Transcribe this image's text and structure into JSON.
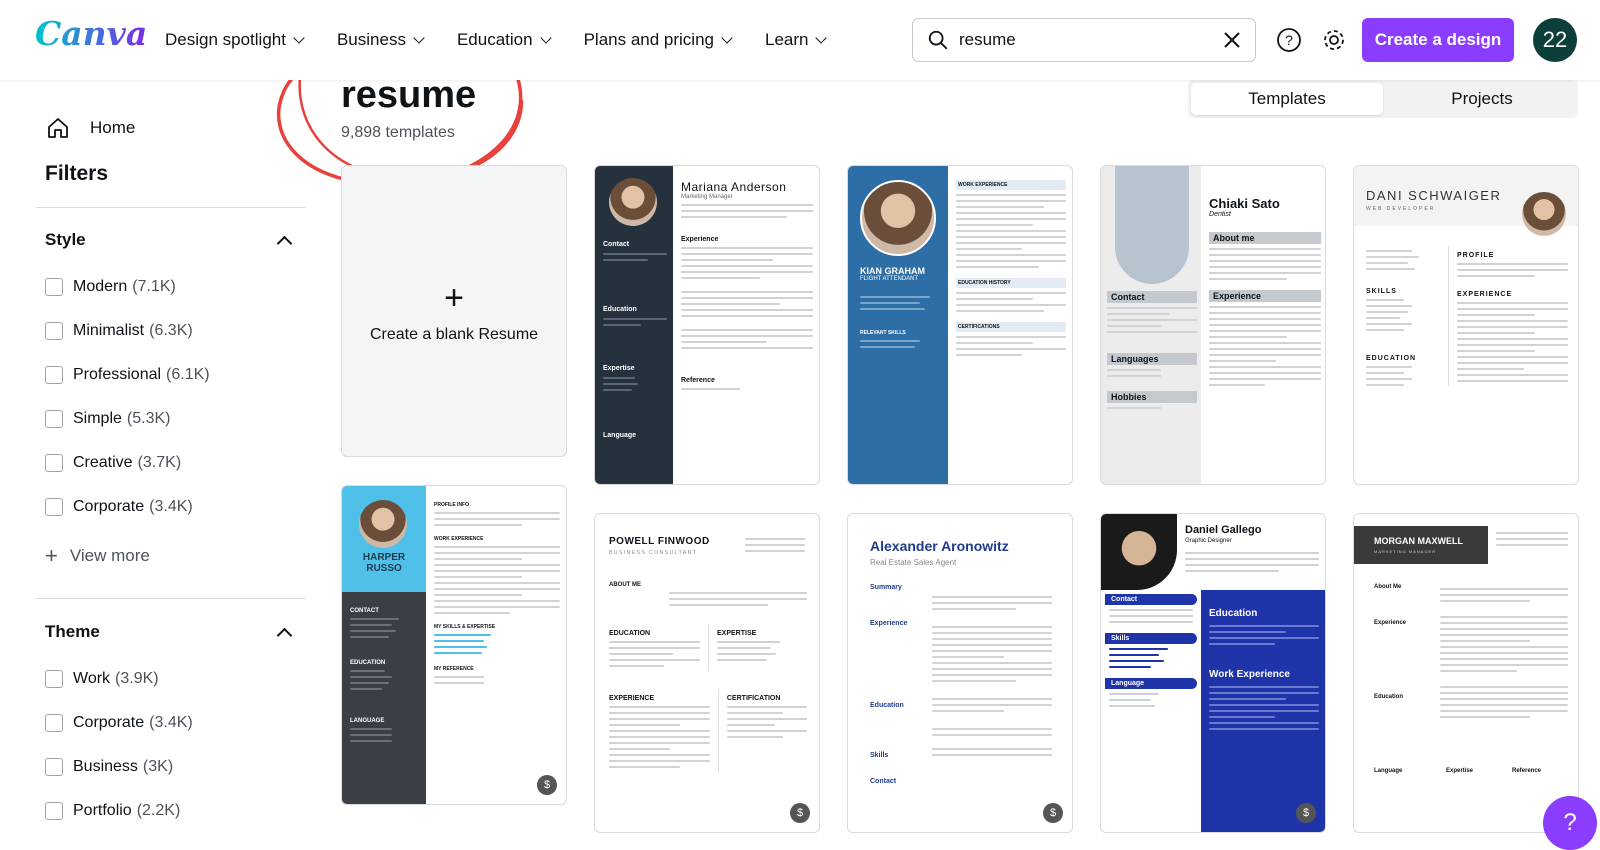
{
  "header": {
    "logo": "Canva",
    "nav": [
      "Design spotlight",
      "Business",
      "Education",
      "Plans and pricing",
      "Learn"
    ],
    "search_value": "resume",
    "create_label": "Create a design",
    "avatar_text": "22"
  },
  "sidebar": {
    "home_label": "Home",
    "filters_title": "Filters",
    "style_title": "Style",
    "style_items": [
      {
        "label": "Modern",
        "count": "(7.1K)"
      },
      {
        "label": "Minimalist",
        "count": "(6.3K)"
      },
      {
        "label": "Professional",
        "count": "(6.1K)"
      },
      {
        "label": "Simple",
        "count": "(5.3K)"
      },
      {
        "label": "Creative",
        "count": "(3.7K)"
      },
      {
        "label": "Corporate",
        "count": "(3.4K)"
      }
    ],
    "view_more": "View more",
    "theme_title": "Theme",
    "theme_items": [
      {
        "label": "Work",
        "count": "(3.9K)"
      },
      {
        "label": "Corporate",
        "count": "(3.4K)"
      },
      {
        "label": "Business",
        "count": "(3K)"
      },
      {
        "label": "Portfolio",
        "count": "(2.2K)"
      }
    ]
  },
  "main": {
    "title": "resume",
    "subtitle": "9,898 templates",
    "tabs": [
      "Templates",
      "Projects"
    ],
    "blank_label": "Create a blank Resume"
  },
  "templates": {
    "mariana": {
      "name": "Mariana Anderson",
      "role": "Marketing Manager",
      "s1": "Contact",
      "s2": "Education",
      "s3": "Expertise",
      "s4": "Language",
      "s5": "Experience",
      "s6": "Reference"
    },
    "kian": {
      "name": "KIAN GRAHAM",
      "role": "FLIGHT ATTENDANT",
      "s1": "WORK EXPERIENCE",
      "s2": "EDUCATION HISTORY",
      "s3": "CERTIFICATIONS",
      "s4": "RELEVANT SKILLS"
    },
    "chiaki": {
      "name": "Chiaki Sato",
      "role": "Dentist",
      "s1": "About me",
      "s2": "Contact",
      "s3": "Experience",
      "s4": "Languages",
      "s5": "Hobbies"
    },
    "dani": {
      "name": "DANI SCHWAIGER",
      "role": "WEB DEVELOPER",
      "s1": "PROFILE",
      "s2": "SKILLS",
      "s3": "EXPERIENCE",
      "s4": "EDUCATION"
    },
    "harper": {
      "name": "HARPER RUSSO",
      "s1": "PROFILE INFO",
      "s2": "WORK EXPERIENCE",
      "s3": "CONTACT",
      "s4": "EDUCATION",
      "s5": "MY SKILLS & EXPERTISE",
      "s6": "LANGUAGE",
      "s7": "MY REFERENCE"
    },
    "powell": {
      "name": "POWELL FINWOOD",
      "role": "BUSINESS CONSULTANT",
      "s1": "ABOUT ME",
      "s2": "EDUCATION",
      "s3": "EXPERTISE",
      "s4": "EXPERIENCE",
      "s5": "CERTIFICATION"
    },
    "alexander": {
      "name": "Alexander Aronowitz",
      "role": "Real Estate Sales Agent",
      "s1": "Summary",
      "s2": "Experience",
      "s3": "Education",
      "s4": "Skills",
      "s5": "Contact"
    },
    "daniel": {
      "name": "Daniel Gallego",
      "role": "Graphic Designer",
      "s1": "Contact",
      "s2": "Education",
      "s3": "Skills",
      "s4": "Work Experience",
      "s5": "Language"
    },
    "morgan": {
      "name": "MORGAN MAXWELL",
      "role": "MARKETING MANAGER",
      "s1": "About Me",
      "s2": "Experience",
      "s3": "Education",
      "s4": "Language",
      "s5": "Expertise",
      "s6": "Reference"
    }
  },
  "badges": {
    "pro": "$"
  },
  "help": "?",
  "colors": {
    "accent": "#8b3dff",
    "avatar": "#0c3f3a",
    "scribble": "#e8403a"
  }
}
